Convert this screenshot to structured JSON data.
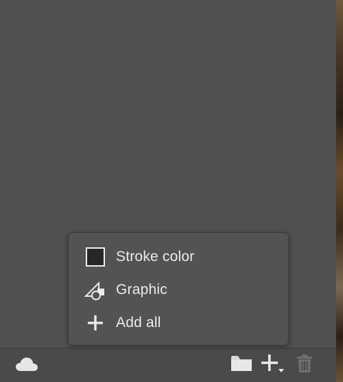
{
  "colors": {
    "panel_bg": "#505050",
    "menu_bg": "#535353",
    "text": "#ececec",
    "stroke_swatch": "#2a2627"
  },
  "menu": {
    "items": [
      {
        "label": "Stroke color",
        "icon": "color-swatch-icon"
      },
      {
        "label": "Graphic",
        "icon": "graphic-icon"
      },
      {
        "label": "Add all",
        "icon": "plus-icon"
      }
    ]
  },
  "footer": {
    "buttons": [
      {
        "icon": "cloud-icon"
      },
      {
        "icon": "folder-icon"
      },
      {
        "icon": "plus-dropdown-icon"
      },
      {
        "icon": "trash-icon",
        "state": "disabled"
      }
    ]
  }
}
